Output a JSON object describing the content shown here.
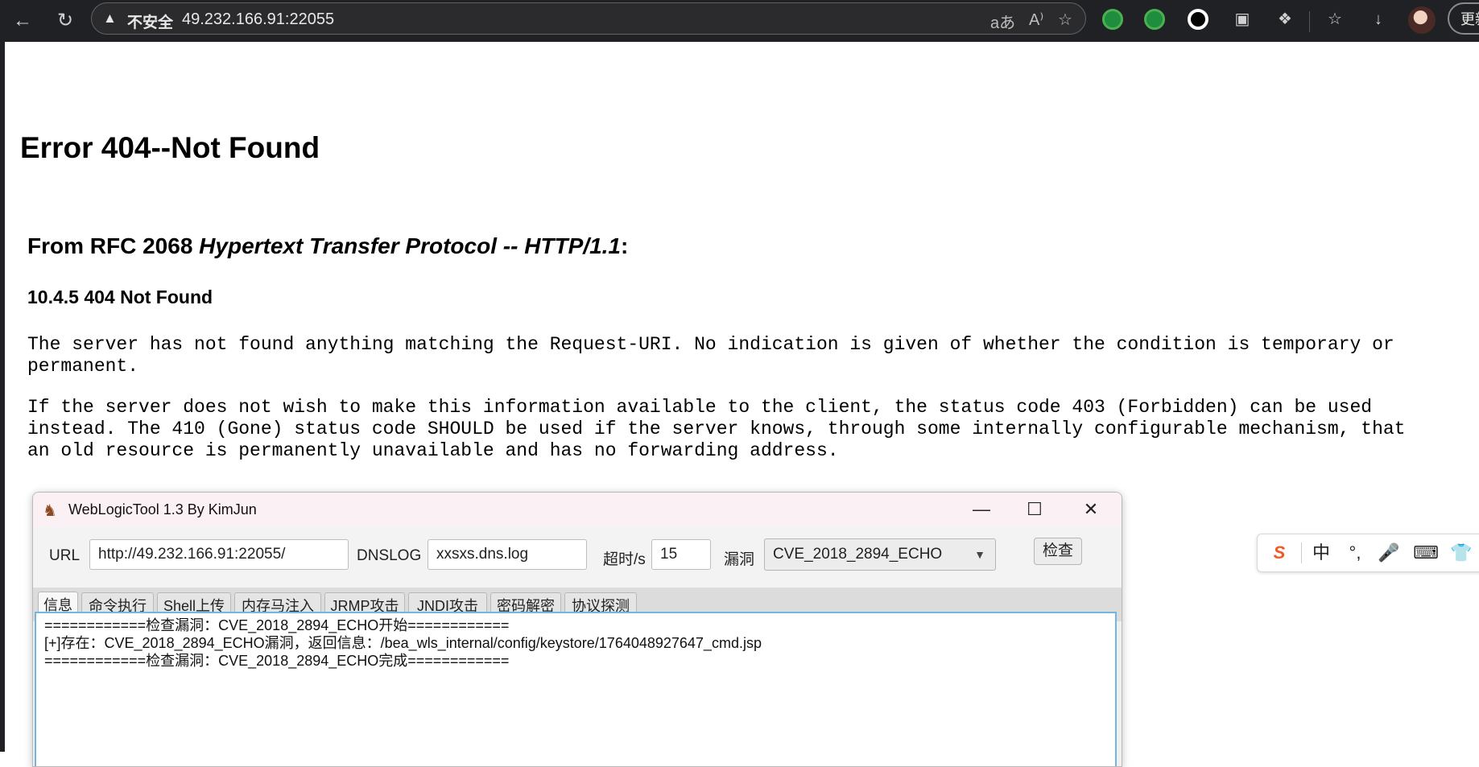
{
  "browser": {
    "security_label": "不安全",
    "url": "49.232.166.91:22055",
    "update_label": "更新"
  },
  "page": {
    "title": "Error 404--Not Found",
    "rfc_prefix": "From RFC 2068 ",
    "rfc_italic": "Hypertext Transfer Protocol -- HTTP/1.1",
    "rfc_suffix": ":",
    "section": "10.4.5 404 Not Found",
    "para1": "The server has not found anything matching the Request-URI. No indication is given of whether the condition is temporary or\npermanent.",
    "para2": "If the server does not wish to make this information available to the client, the status code 403 (Forbidden) can be used\ninstead. The 410 (Gone) status code SHOULD be used if the server knows, through some internally configurable mechanism, that\nan old resource is permanently unavailable and has no forwarding address."
  },
  "app": {
    "title": "WebLogicTool 1.3 By KimJun",
    "url_label": "URL",
    "url_value": "http://49.232.166.91:22055/",
    "dnslog_label": "DNSLOG",
    "dnslog_value": "xxsxs.dns.log",
    "timeout_label": "超时/s",
    "timeout_value": "15",
    "vuln_label": "漏洞",
    "vuln_value": "CVE_2018_2894_ECHO",
    "check_label": "检查",
    "tabs": [
      "信息",
      "命令执行",
      "Shell上传",
      "内存马注入",
      "JRMP攻击",
      "JNDI攻击",
      "密码解密",
      "协议探测"
    ],
    "output": "============检查漏洞：CVE_2018_2894_ECHO开始============\n[+]存在：CVE_2018_2894_ECHO漏洞，返回信息：/bea_wls_internal/config/keystore/1764048927647_cmd.jsp\n============检查漏洞：CVE_2018_2894_ECHO完成============"
  },
  "ime": {
    "lang": "中"
  }
}
